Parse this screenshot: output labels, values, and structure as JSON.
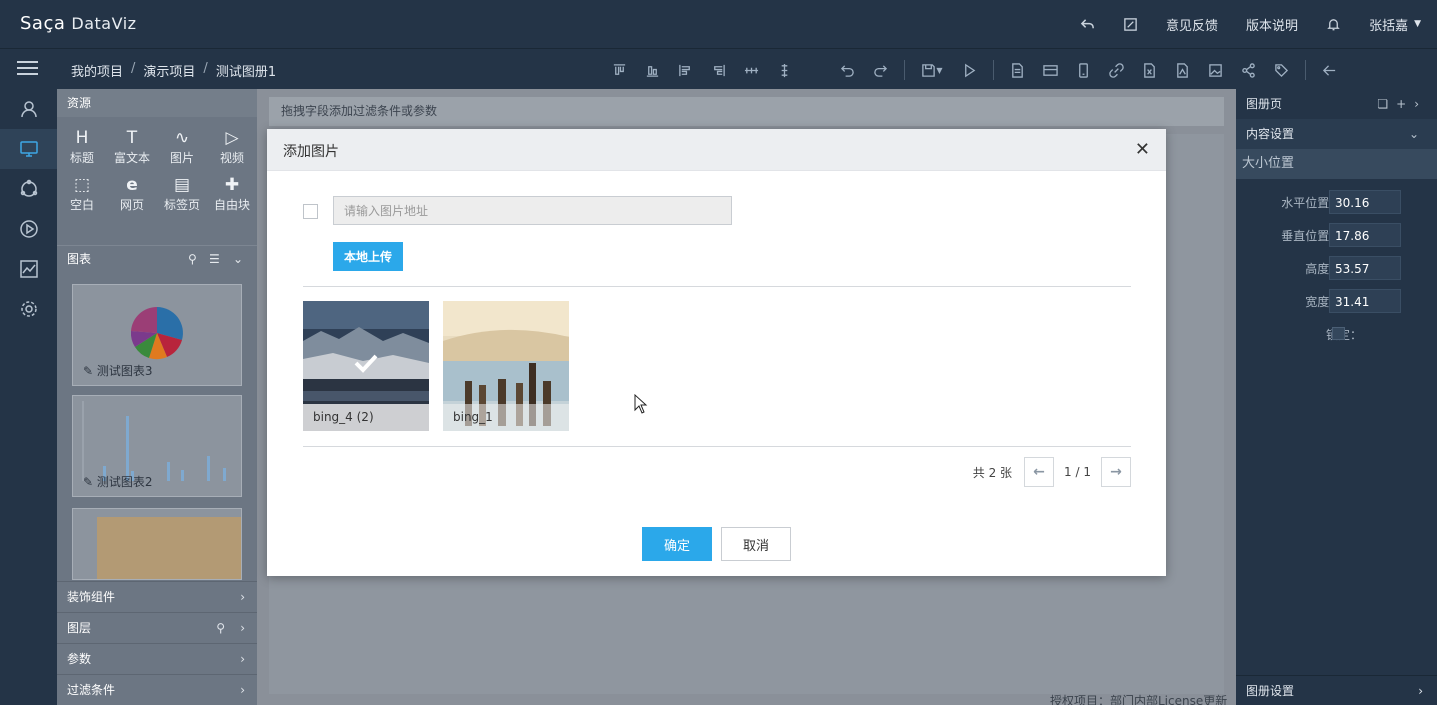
{
  "app": {
    "logo_left": "Saça",
    "logo_right": "DataViz"
  },
  "topbar": {
    "feedback": "意见反馈",
    "version_notes": "版本说明",
    "user": "张括嘉"
  },
  "breadcrumb": {
    "items": [
      "我的项目",
      "演示项目",
      "测试图册1"
    ],
    "sep": "/"
  },
  "resources": {
    "title": "资源",
    "items": [
      {
        "glyph": "H",
        "label": "标题"
      },
      {
        "glyph": "T",
        "label": "富文本"
      },
      {
        "glyph": "∿",
        "label": "图片"
      },
      {
        "glyph": "▷",
        "label": "视频"
      },
      {
        "glyph": "⬚",
        "label": "空白"
      },
      {
        "glyph": "e",
        "label": "网页"
      },
      {
        "glyph": "▤",
        "label": "标签页"
      },
      {
        "glyph": "✚",
        "label": "自由块"
      }
    ]
  },
  "charts": {
    "title": "图表",
    "thumbs": [
      "测试图表3",
      "测试图表2"
    ]
  },
  "sections": [
    "装饰组件",
    "图层",
    "参数",
    "过滤条件"
  ],
  "canvas": {
    "filter_hint": "拖拽字段添加过滤条件或参数",
    "license": "授权项目：部门内部License更新"
  },
  "right_panel": {
    "page_title": "图册页",
    "content_settings": "内容设置",
    "size_position": "大小位置",
    "props": [
      {
        "label": "水平位置(%)：",
        "value": "30.16"
      },
      {
        "label": "垂直位置(%)：",
        "value": "17.86"
      },
      {
        "label": "高度(%)：",
        "value": "53.57"
      },
      {
        "label": "宽度(%)：",
        "value": "31.41"
      }
    ],
    "lock_label": "锁定：",
    "bottom": "图册设置"
  },
  "modal": {
    "title": "添加图片",
    "url_placeholder": "请输入图片地址",
    "upload": "本地上传",
    "images": [
      {
        "name": "bing_4 (2)",
        "selected": true
      },
      {
        "name": "bing_1",
        "selected": false
      }
    ],
    "total": "共 2 张",
    "page": "1 / 1",
    "ok": "确定",
    "cancel": "取消"
  },
  "colors": {
    "accent": "#2ba8ea",
    "topbar": "#243447"
  }
}
